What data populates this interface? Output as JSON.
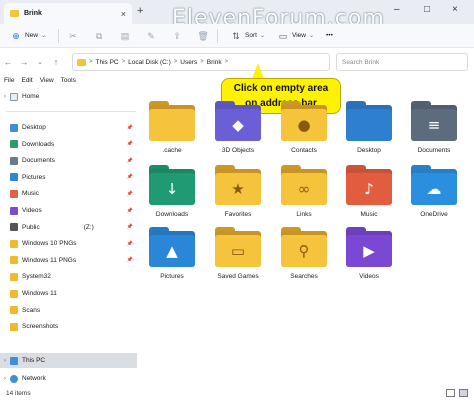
{
  "tab": {
    "title": "Brink",
    "close": "×",
    "new_tab": "+"
  },
  "watermark": "ElevenForum.com",
  "window_controls": [
    "–",
    "□",
    "×"
  ],
  "commands": {
    "new_label": "New",
    "sort_label": "Sort",
    "view_label": "View",
    "more_label": "•••"
  },
  "address": {
    "crumbs": [
      "This PC",
      "Local Disk (C:)",
      "Users",
      "Brink"
    ],
    "separator": ">",
    "search_placeholder": "Search Brink"
  },
  "menu": [
    "File",
    "Edit",
    "View",
    "Tools"
  ],
  "callout": {
    "line1": "Click on empty area",
    "line2": "on address bar",
    "color": "#fff200"
  },
  "sidebar": {
    "home": "Home",
    "quick": [
      {
        "label": "Desktop",
        "icon": "desktop-icon",
        "color": "#3f8fd8"
      },
      {
        "label": "Downloads",
        "icon": "downloads-icon",
        "color": "#2a9d6f"
      },
      {
        "label": "Documents",
        "icon": "documents-icon",
        "color": "#6b7a8f"
      },
      {
        "label": "Pictures",
        "icon": "pictures-icon",
        "color": "#2b88d8"
      },
      {
        "label": "Music",
        "icon": "music-icon",
        "color": "#e0623e"
      },
      {
        "label": "Videos",
        "icon": "videos-icon",
        "color": "#7a4fcf"
      },
      {
        "label": "Public",
        "icon": "network-drive-icon",
        "color": "#555555",
        "suffix": "(Z:)"
      },
      {
        "label": "Windows 10 PNGs",
        "icon": "folder-icon",
        "color": "#f2b92e"
      },
      {
        "label": "Windows 11 PNGs",
        "icon": "folder-icon",
        "color": "#f2b92e"
      },
      {
        "label": "System32",
        "icon": "folder-icon",
        "color": "#f2b92e"
      },
      {
        "label": "Windows 11",
        "icon": "folder-icon",
        "color": "#f2b92e"
      },
      {
        "label": "Scans",
        "icon": "folder-icon",
        "color": "#f2b92e"
      },
      {
        "label": "Screenshots",
        "icon": "folder-icon",
        "color": "#f2b92e"
      }
    ],
    "this_pc": "This PC",
    "network": "Network"
  },
  "folders": [
    {
      "label": ".cache",
      "icon": "folder-icon",
      "glyph": "",
      "color": "#f6c43c"
    },
    {
      "label": "3D Objects",
      "icon": "3d-objects-folder-icon",
      "glyph": "◆",
      "color": "#6a5fd6"
    },
    {
      "label": "Contacts",
      "icon": "contacts-folder-icon",
      "glyph": "●",
      "color": "#f6c43c"
    },
    {
      "label": "Desktop",
      "icon": "desktop-folder-icon",
      "glyph": "",
      "color": "#2f7fd0"
    },
    {
      "label": "Documents",
      "icon": "documents-folder-icon",
      "glyph": "≡",
      "color": "#5d6b7f"
    },
    {
      "label": "Downloads",
      "icon": "downloads-folder-icon",
      "glyph": "↓",
      "color": "#1f9a72"
    },
    {
      "label": "Favorites",
      "icon": "favorites-folder-icon",
      "glyph": "★",
      "color": "#f6c43c"
    },
    {
      "label": "Links",
      "icon": "links-folder-icon",
      "glyph": "∞",
      "color": "#f6c43c"
    },
    {
      "label": "Music",
      "icon": "music-folder-icon",
      "glyph": "♪",
      "color": "#e25d3f"
    },
    {
      "label": "OneDrive",
      "icon": "onedrive-folder-icon",
      "glyph": "☁",
      "color": "#2b8fe0"
    },
    {
      "label": "Pictures",
      "icon": "pictures-folder-icon",
      "glyph": "▲",
      "color": "#2a86d6"
    },
    {
      "label": "Saved Games",
      "icon": "saved-games-folder-icon",
      "glyph": "▭",
      "color": "#f6c43c"
    },
    {
      "label": "Searches",
      "icon": "searches-folder-icon",
      "glyph": "⚲",
      "color": "#f6c43c"
    },
    {
      "label": "Videos",
      "icon": "videos-folder-icon",
      "glyph": "▶",
      "color": "#7a48d2"
    }
  ],
  "status": {
    "count": "14 items"
  }
}
